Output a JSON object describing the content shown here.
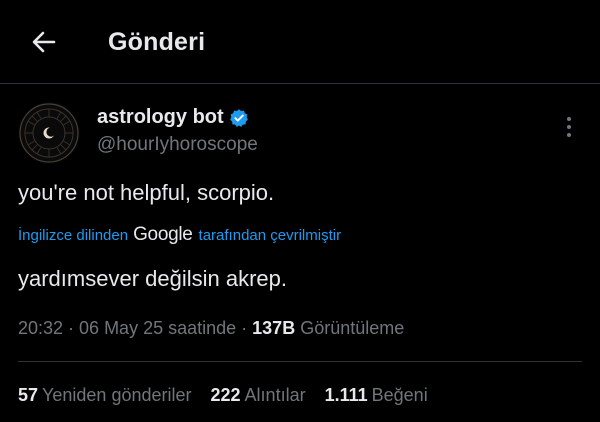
{
  "header": {
    "title": "Gönderi"
  },
  "tweet": {
    "author_name": "astrology bot",
    "handle": "@hourIyhoroscope",
    "text": "you're not helpful, scorpio.",
    "translation": {
      "prefix": "İngilizce dilinden",
      "provider": "Google",
      "suffix": "tarafından çevrilmiştir"
    },
    "translated_text": "yardımsever değilsin akrep.",
    "timestamp": "20:32 · 06 May 25 saatinde",
    "separator": " · ",
    "views_count": "137B",
    "views_label": "Görüntüleme"
  },
  "stats": [
    {
      "count": "57",
      "label": "Yeniden gönderiler"
    },
    {
      "count": "222",
      "label": "Alıntılar"
    },
    {
      "count": "1.111",
      "label": "Beğeni"
    }
  ],
  "colors": {
    "background": "#000000",
    "text": "#e7e9ea",
    "muted": "#71767b",
    "accent": "#1d9bf0",
    "divider": "#2f3336"
  },
  "icons": {
    "back": "arrow-left-icon",
    "verified": "verified-badge-icon",
    "more": "more-vertical-icon"
  }
}
